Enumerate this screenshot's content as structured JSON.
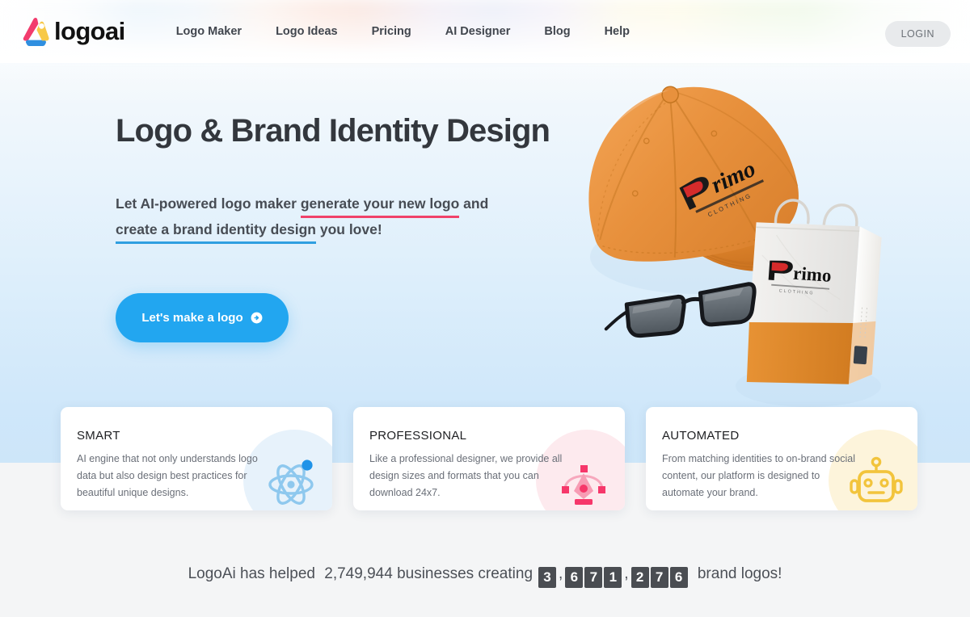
{
  "brand": {
    "name": "logoai",
    "mark": "logoai-triangle-mark"
  },
  "nav": {
    "items": [
      {
        "label": "Logo Maker"
      },
      {
        "label": "Logo Ideas"
      },
      {
        "label": "Pricing"
      },
      {
        "label": "AI Designer"
      },
      {
        "label": "Blog"
      },
      {
        "label": "Help"
      }
    ],
    "login_label": "LOGIN"
  },
  "hero": {
    "title": "Logo & Brand Identity Design",
    "sub_part1": "Let AI-powered logo maker ",
    "sub_highlight1": "generate your new logo",
    "sub_part2": " and",
    "sub_highlight2": "create a brand identity design",
    "sub_part3": " you love!",
    "cta_label": "Let's make a logo",
    "cta_icon": "arrow-right-circle-icon",
    "art": {
      "cap_brand": "Primo",
      "bag_brand": "Primo",
      "items": [
        "baseball-cap",
        "sunglasses",
        "shopping-bag"
      ]
    }
  },
  "cards": [
    {
      "title": "SMART",
      "body": "AI engine that not only understands logo data but also design best practices for beautiful unique designs.",
      "icon": "atom-icon",
      "blob_color": "#e7f2fb",
      "icon_color": "#7fc2ec",
      "accent_color": "#1f93e8"
    },
    {
      "title": "PROFESSIONAL",
      "body": "Like a professional designer, we provide all design sizes and formats that you can download 24x7.",
      "icon": "pen-tool-icon",
      "blob_color": "#fdeaee",
      "icon_color": "#f7a8bd",
      "accent_color": "#f6376a"
    },
    {
      "title": "AUTOMATED",
      "body": "From matching identities to on-brand social content, our platform is designed to automate your brand.",
      "icon": "robot-icon",
      "blob_color": "#fdf4db",
      "icon_color": "#f5c githubusercontent",
      "accent_color": "#f2c43c"
    }
  ],
  "counter": {
    "prefix": "LogoAi has helped",
    "businesses": "2,749,944",
    "middle": "businesses creating",
    "digits": [
      "3",
      ",",
      "6",
      "7",
      "1",
      ",",
      "2",
      "7",
      "6"
    ],
    "suffix": "brand logos!"
  },
  "colors": {
    "brand_pink": "#f0426a",
    "brand_blue": "#2f9fe0",
    "cta_blue": "#22a6f0",
    "logo_pink": "#f23c6d",
    "logo_blue": "#2f8fe0",
    "logo_yellow": "#f7c948",
    "hero_bg_top": "#fbfcfd",
    "hero_bg_bottom": "#cde6f9",
    "page_bg": "#f4f5f6"
  }
}
